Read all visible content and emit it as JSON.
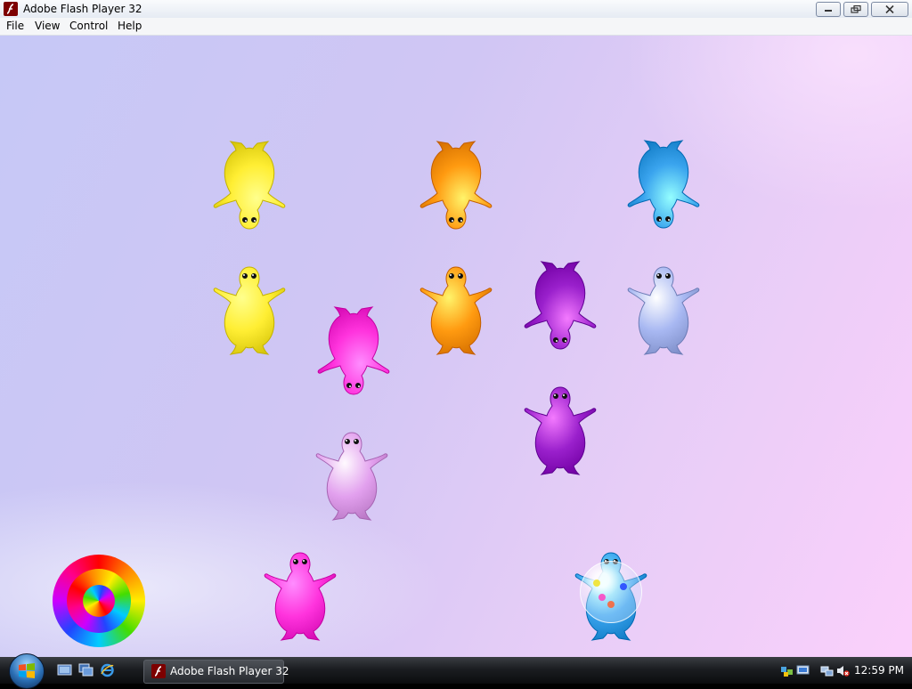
{
  "window": {
    "title": "Adobe Flash Player 32",
    "app_icon": "flash-icon"
  },
  "menu": {
    "items": [
      "File",
      "View",
      "Control",
      "Help"
    ]
  },
  "stage": {
    "creatures": [
      {
        "id": "yellow-creature-upside-down",
        "color": "#ffee33",
        "orientation": "upside-down"
      },
      {
        "id": "orange-creature-upside-down",
        "color": "#ff9a10",
        "orientation": "upside-down"
      },
      {
        "id": "blue-creature-upside-down",
        "color": "#3aa4ee",
        "orientation": "upside-down"
      },
      {
        "id": "yellow-creature",
        "color": "#ffee33",
        "orientation": "upright"
      },
      {
        "id": "orange-creature",
        "color": "#ff9a10",
        "orientation": "upright"
      },
      {
        "id": "purple-creature-upside-down",
        "color": "#9a20cc",
        "orientation": "upside-down"
      },
      {
        "id": "light-blue-creature",
        "color": "#a8b8f2",
        "orientation": "upright"
      },
      {
        "id": "magenta-creature-upside-down",
        "color": "#ff33dd",
        "orientation": "upside-down"
      },
      {
        "id": "purple-creature",
        "color": "#9a20cc",
        "orientation": "upright"
      },
      {
        "id": "pale-pink-creature",
        "color": "#e2a0ee",
        "orientation": "upright"
      },
      {
        "id": "magenta-creature-bottom",
        "color": "#ff33dd",
        "orientation": "upright"
      },
      {
        "id": "blue-creature-bottom",
        "color": "#3aa4ee",
        "orientation": "upright"
      }
    ],
    "spiral_icon": "rainbow-spiral-icon",
    "bubble_icon": "bubble-icon"
  },
  "taskbar": {
    "start_icon": "windows-start-icon",
    "quick_launch": [
      "show-desktop-icon",
      "switch-windows-icon",
      "internet-explorer-icon"
    ],
    "task_button_label": "Adobe Flash Player 32",
    "tray_icons": [
      "network-icon",
      "volume-muted-icon"
    ],
    "clock": "12:59 PM"
  }
}
